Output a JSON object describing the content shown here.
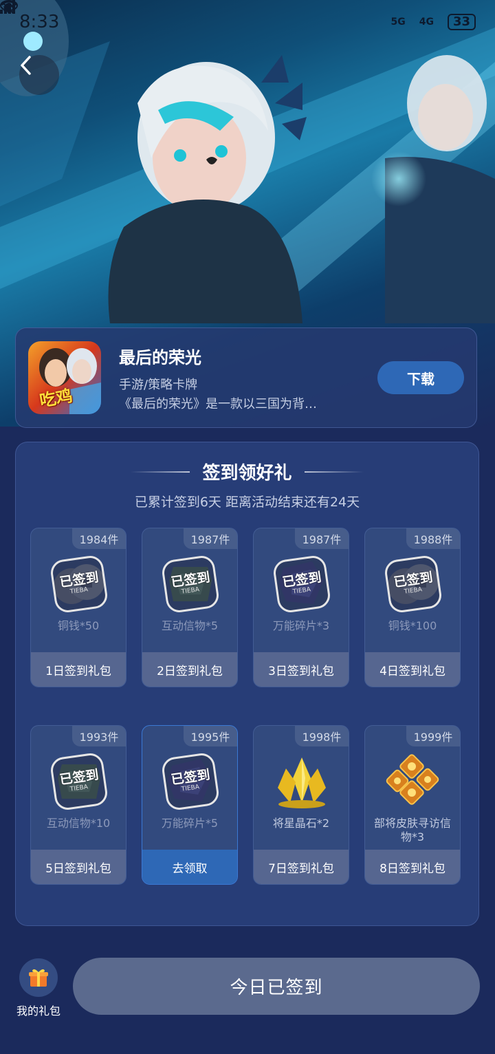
{
  "status_bar": {
    "time": "8:33",
    "network_1": "5G",
    "network_2": "4G",
    "battery": "33"
  },
  "game": {
    "title": "最后的荣光",
    "genre": "手游/策略卡牌",
    "description": "《最后的荣光》是一款以三国为背…",
    "icon_badge": "吃鸡",
    "download_label": "下载"
  },
  "signin": {
    "title": "签到领好礼",
    "subtitle": "已累计签到6天 距离活动结束还有24天",
    "stamp_text": "已签到",
    "stamp_sub": "TIEBA",
    "days": [
      {
        "count": "1984件",
        "name": "铜钱*50",
        "footer": "1日签到礼包",
        "state": "signed",
        "icon": "coin"
      },
      {
        "count": "1987件",
        "name": "互动信物*5",
        "footer": "2日签到礼包",
        "state": "signed",
        "icon": "token"
      },
      {
        "count": "1987件",
        "name": "万能碎片*3",
        "footer": "3日签到礼包",
        "state": "signed",
        "icon": "shard"
      },
      {
        "count": "1988件",
        "name": "铜钱*100",
        "footer": "4日签到礼包",
        "state": "signed",
        "icon": "coin"
      },
      {
        "count": "1993件",
        "name": "互动信物*10",
        "footer": "5日签到礼包",
        "state": "signed",
        "icon": "token"
      },
      {
        "count": "1995件",
        "name": "万能碎片*5",
        "footer": "去领取",
        "state": "claim",
        "icon": "shard"
      },
      {
        "count": "1998件",
        "name": "将星晶石*2",
        "footer": "7日签到礼包",
        "state": "locked",
        "icon": "crystal"
      },
      {
        "count": "1999件",
        "name": "部将皮肤寻访信物*3",
        "footer": "8日签到礼包",
        "state": "locked",
        "icon": "skin-token"
      }
    ]
  },
  "bottom": {
    "gift_label": "我的礼包",
    "signed_button": "今日已签到"
  },
  "colors": {
    "background": "#1b2a5c",
    "accent": "#2e68b6",
    "disabled_button": "#5b6a8e"
  }
}
